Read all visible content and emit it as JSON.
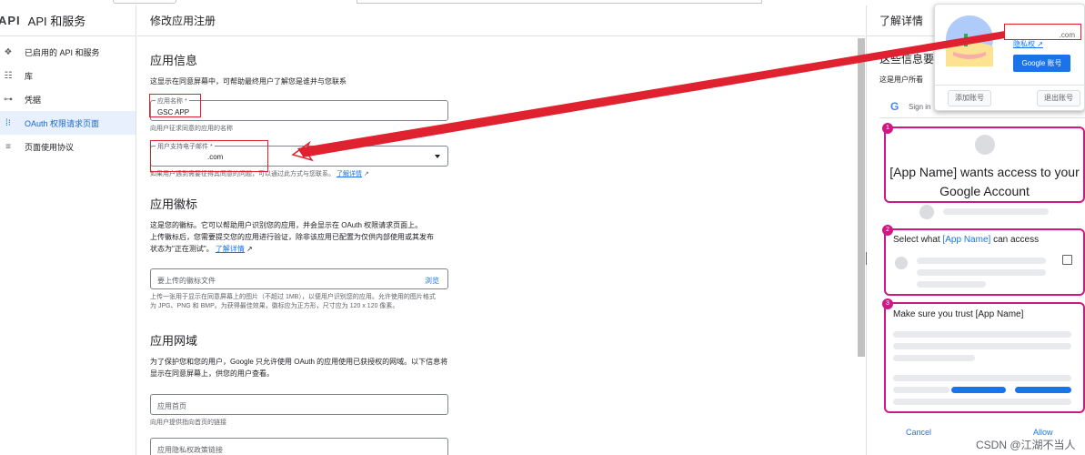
{
  "leftnav": {
    "logo": "API",
    "title": "API 和服务",
    "items": [
      {
        "icon": "enabled-apis-icon",
        "glyph": "❖",
        "label": "已启用的 API 和服务"
      },
      {
        "icon": "library-icon",
        "glyph": "☷",
        "label": "库"
      },
      {
        "icon": "credentials-icon",
        "glyph": "⊶",
        "label": "凭据"
      },
      {
        "icon": "oauth-consent-icon",
        "glyph": "⁞⁝",
        "label": "OAuth 权限请求页面"
      },
      {
        "icon": "page-usage-icon",
        "glyph": "≡",
        "label": "页面使用协议"
      }
    ]
  },
  "main": {
    "header": "修改应用注册",
    "app_info": {
      "title": "应用信息",
      "desc": "这显示在同意屏幕中，可帮助最终用户了解您是谁并与您联系",
      "name_label": "应用名称 *",
      "name_value": "GSC APP",
      "name_help": "向用户征求同意的应用的名称",
      "email_label": "用户支持电子邮件 *",
      "email_value": ".com",
      "email_help": "如果用户遇到需要征得其同意的问题，可以通过此方式与您联系。",
      "email_help_link": "了解详情"
    },
    "logo_section": {
      "title": "应用徽标",
      "desc1": "这是您的徽标。它可以帮助用户识别您的应用，并会显示在 OAuth 权限请求页面上。",
      "desc2": "上传徽标后，您需要提交您的应用进行验证，除非该应用已配置为仅供内部使用或其发布",
      "desc3": "状态为\"正在测试\"。",
      "desc_link": "了解详情",
      "upload_placeholder": "要上传的徽标文件",
      "browse": "浏览",
      "upload_help": "上传一张用于显示在同意屏幕上的图片（不超过 1MB），以便用户识别您的应用。允许使用的图片格式为 JPG、PNG 和 BMP。为获得最佳效果，徽标应为正方形，尺寸应为 120 x 120 像素。"
    },
    "domain_section": {
      "title": "应用网域",
      "desc": "为了保护您和您的用户，Google 只允许使用 OAuth 的应用使用已获授权的网域。以下信息将显示在同意屏幕上，供您的用户查看。",
      "homepage_placeholder": "应用首页",
      "homepage_help": "向用户提供指向首页的链接",
      "privacy_placeholder": "应用隐私权政策链接"
    }
  },
  "right": {
    "header": "了解详情",
    "subtitle": "这些信息要",
    "subline": "这是用户所看",
    "signin": "Sign in",
    "card1_num": "1",
    "card1_text": "[App Name] wants access to your Google Account",
    "card2_num": "2",
    "card2_pre": "Select what ",
    "card2_hl": "[App Name]",
    "card2_post": " can access",
    "card3_num": "3",
    "card3_text": "Make sure you trust [App Name]",
    "cancel": "Cancel",
    "allow": "Allow"
  },
  "popup": {
    "email": ".com",
    "privacy": "隐私权",
    "google_account": "Google 账号",
    "add_account": "添加账号",
    "sign_out": "退出账号"
  },
  "watermark": "CSDN @江湖不当人",
  "colors": {
    "accent": "#1a73e8",
    "annotation": "#e0212f",
    "card_border": "#d01884"
  }
}
